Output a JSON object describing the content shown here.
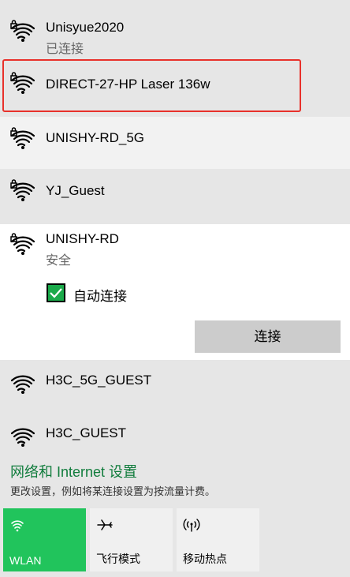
{
  "networks": [
    {
      "ssid": "Unisyue2020",
      "status": "已连接"
    },
    {
      "ssid": "DIRECT-27-HP Laser 136w"
    },
    {
      "ssid": "UNISHY-RD_5G"
    },
    {
      "ssid": "YJ_Guest"
    },
    {
      "ssid": "UNISHY-RD",
      "status": "安全"
    },
    {
      "ssid": "H3C_5G_GUEST"
    },
    {
      "ssid": "H3C_GUEST"
    }
  ],
  "auto_connect": {
    "label": "自动连接",
    "checked": true
  },
  "connect_button": "连接",
  "settings": {
    "title": "网络和 Internet 设置",
    "description": "更改设置，例如将某连接设置为按流量计费。"
  },
  "quick_actions": [
    {
      "label": "WLAN",
      "icon": "wifi-icon",
      "active": true
    },
    {
      "label": "飞行模式",
      "icon": "airplane-icon",
      "active": false
    },
    {
      "label": "移动热点",
      "icon": "hotspot-icon",
      "active": false
    }
  ],
  "colors": {
    "accent": "#21c45c",
    "link": "#107c3c",
    "highlight_border": "#e8312b"
  }
}
